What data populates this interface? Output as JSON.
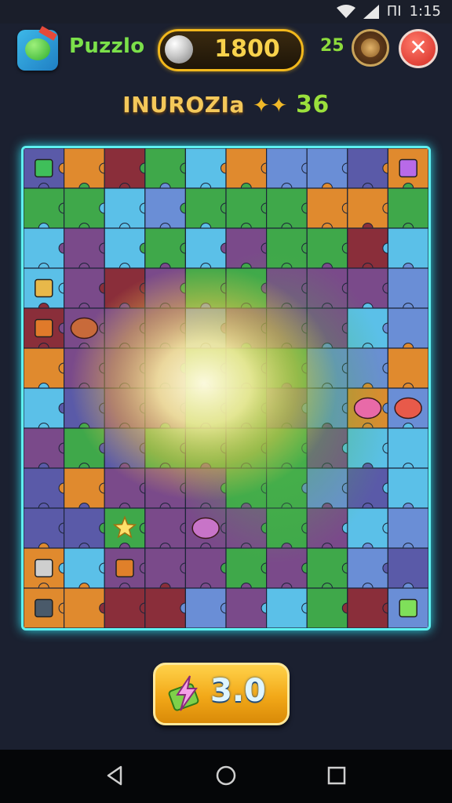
{
  "status_bar": {
    "icons": [
      "wifi-icon",
      "signal-icon",
      "battery-icon"
    ],
    "battery_label": "ΠI",
    "time": "1:15"
  },
  "header": {
    "app_icon": "chat-bubble-icon",
    "app_name": "Puzzlo",
    "coins": "1800",
    "level": "25",
    "badge_icon": "cookie-badge-icon",
    "close_icon": "close-icon"
  },
  "title": {
    "text": "INUROZIa",
    "stars": "✦✦",
    "stars_count": "36"
  },
  "board": {
    "rows": 12,
    "cols": 10,
    "palette": [
      "#e08a2e",
      "#3fa84a",
      "#6a8ed6",
      "#7a4a8a",
      "#5bc0e8",
      "#8a2e3a",
      "#5a5aa8"
    ],
    "special_pieces": [
      "grid-icon",
      "gem-icon",
      "picture-icon",
      "chest-icon",
      "monster-icon",
      "creature-icon",
      "bug-icon",
      "star-icon",
      "ufo-icon",
      "frame-icon",
      "book-icon",
      "tablet-icon",
      "wand-icon"
    ]
  },
  "boost_button": {
    "icon": "lightning-box-icon",
    "value": "3.0"
  },
  "nav": {
    "back_icon": "back-icon",
    "home_icon": "home-icon",
    "recents_icon": "recents-icon"
  }
}
